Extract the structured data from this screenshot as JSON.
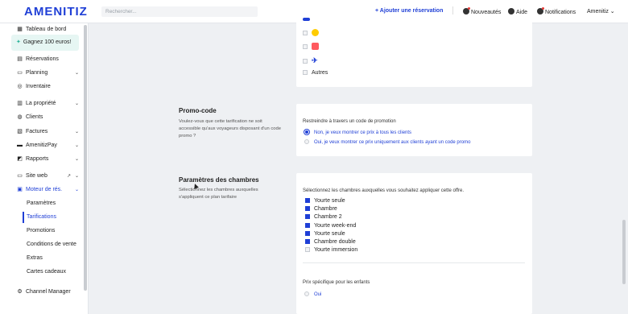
{
  "app": {
    "logo": "AMENITIZ"
  },
  "search": {
    "placeholder": "Rechercher..."
  },
  "topbar": {
    "add_reservation": "+  Ajouter une réservation",
    "news": "Nouveautés",
    "help": "Aide",
    "notifications": "Notifications",
    "account": "Amenitiz ⌄"
  },
  "sidebar": {
    "items": [
      {
        "label": "Tableau de bord",
        "icon": "dashboard-icon"
      },
      {
        "label": "Gagnez 100 euros!",
        "icon": "gift-icon"
      },
      {
        "label": "Réservations",
        "icon": "bookings-icon"
      },
      {
        "label": "Planning",
        "icon": "calendar-icon"
      },
      {
        "label": "Inventaire",
        "icon": "inventory-icon"
      },
      {
        "label": "La propriété",
        "icon": "property-icon"
      },
      {
        "label": "Clients",
        "icon": "clients-icon"
      },
      {
        "label": "Factures",
        "icon": "invoice-icon"
      },
      {
        "label": "AmenitizPay",
        "icon": "card-icon"
      },
      {
        "label": "Rapports",
        "icon": "reports-icon"
      },
      {
        "label": "Site web",
        "icon": "website-icon"
      },
      {
        "label": "Moteur de rés.",
        "icon": "booking-engine-icon"
      },
      {
        "label": "Channel Manager",
        "icon": "channel-icon"
      }
    ],
    "subitems": [
      "Paramètres",
      "Tarifications",
      "Promotions",
      "Conditions de vente",
      "Extras",
      "Cartes cadeaux"
    ]
  },
  "channels": {
    "other_label": "Autres"
  },
  "promo_code": {
    "title": "Promo-code",
    "description": "Voulez-vous que cette tarification ne soit accessible qu'aux voyageurs disposant d'un code promo ?",
    "restrict_label": "Restreindre à travers un code de promotion",
    "options": [
      "Non, je veux montrer ce prix à tous les clients",
      "Oui, je veux montrer ce prix uniquement aux clients ayant un code promo"
    ]
  },
  "rooms": {
    "title": "Paramètres des chambres",
    "description": "Sélectionnez les chambres auxquelles s'appliquent ce plan tarifaire",
    "select_label": "Sélectionnez les chambres auxquelles vous souhaitez appliquer cette offre.",
    "list": [
      {
        "label": "Yourte seule",
        "checked": true
      },
      {
        "label": "Chambre",
        "checked": true
      },
      {
        "label": "Chambre 2",
        "checked": true
      },
      {
        "label": "Yourte week-end",
        "checked": true
      },
      {
        "label": "Yourte seule",
        "checked": true
      },
      {
        "label": "Chambre double",
        "checked": true
      },
      {
        "label": "Yourte immersion",
        "checked": false
      }
    ],
    "children_label": "Prix spécifique pour les enfants",
    "children_option": "Oui"
  },
  "colors": {
    "accent": "#1f3fd6",
    "promo_bg": "#e6f6f3"
  }
}
